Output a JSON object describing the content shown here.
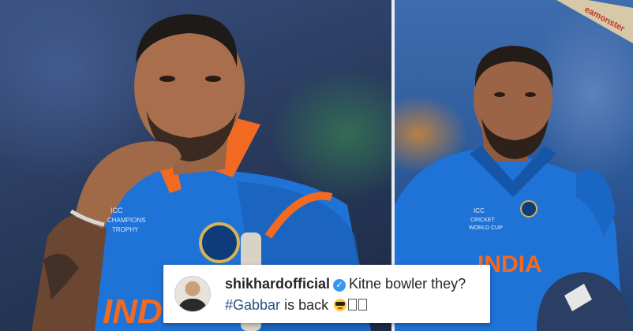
{
  "left_photo": {
    "jersey_text": "INDIA",
    "patch_text": [
      "ICC",
      "CHAMPIONS",
      "TROPHY"
    ]
  },
  "right_photo": {
    "jersey_text": "INDIA",
    "patch_text": [
      "ICC",
      "CRICKET",
      "WORLD CUP"
    ],
    "bat_text": "eamonster"
  },
  "caption": {
    "username": "shikhardofficial",
    "verified_icon": "verified-badge-icon",
    "text": "Kitne bowler they?",
    "hashtag": "#Gabbar",
    "tail": "is back"
  },
  "colors": {
    "jersey_blue": "#1f72d6",
    "jersey_orange": "#f26a21",
    "verified_blue": "#3897f0"
  }
}
